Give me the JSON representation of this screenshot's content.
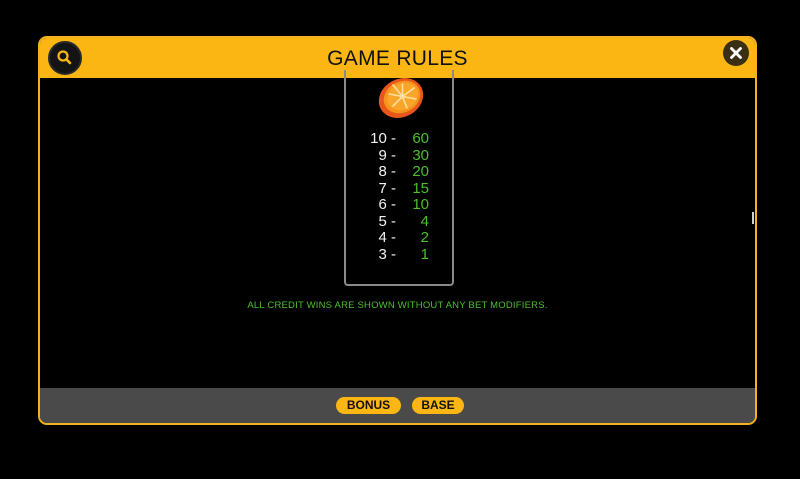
{
  "header": {
    "title": "GAME RULES"
  },
  "icons": {
    "search": "search-icon",
    "close": "close-icon",
    "symbol": "orange-slice-icon"
  },
  "colors": {
    "accent": "#fbb614",
    "win_value": "#4bbf2c",
    "footer": "#4a4a4a"
  },
  "paytable": {
    "rows": [
      {
        "count": "10 -",
        "value": "60"
      },
      {
        "count": "9 -",
        "value": "30"
      },
      {
        "count": "8 -",
        "value": "20"
      },
      {
        "count": "7 -",
        "value": "15"
      },
      {
        "count": "6 -",
        "value": "10"
      },
      {
        "count": "5 -",
        "value": "4"
      },
      {
        "count": "4 -",
        "value": "2"
      },
      {
        "count": "3 -",
        "value": "1"
      }
    ]
  },
  "note": "ALL CREDIT WINS ARE SHOWN WITHOUT ANY BET MODIFIERS.",
  "footer": {
    "tabs": [
      {
        "label": "BONUS"
      },
      {
        "label": "BASE"
      }
    ]
  }
}
